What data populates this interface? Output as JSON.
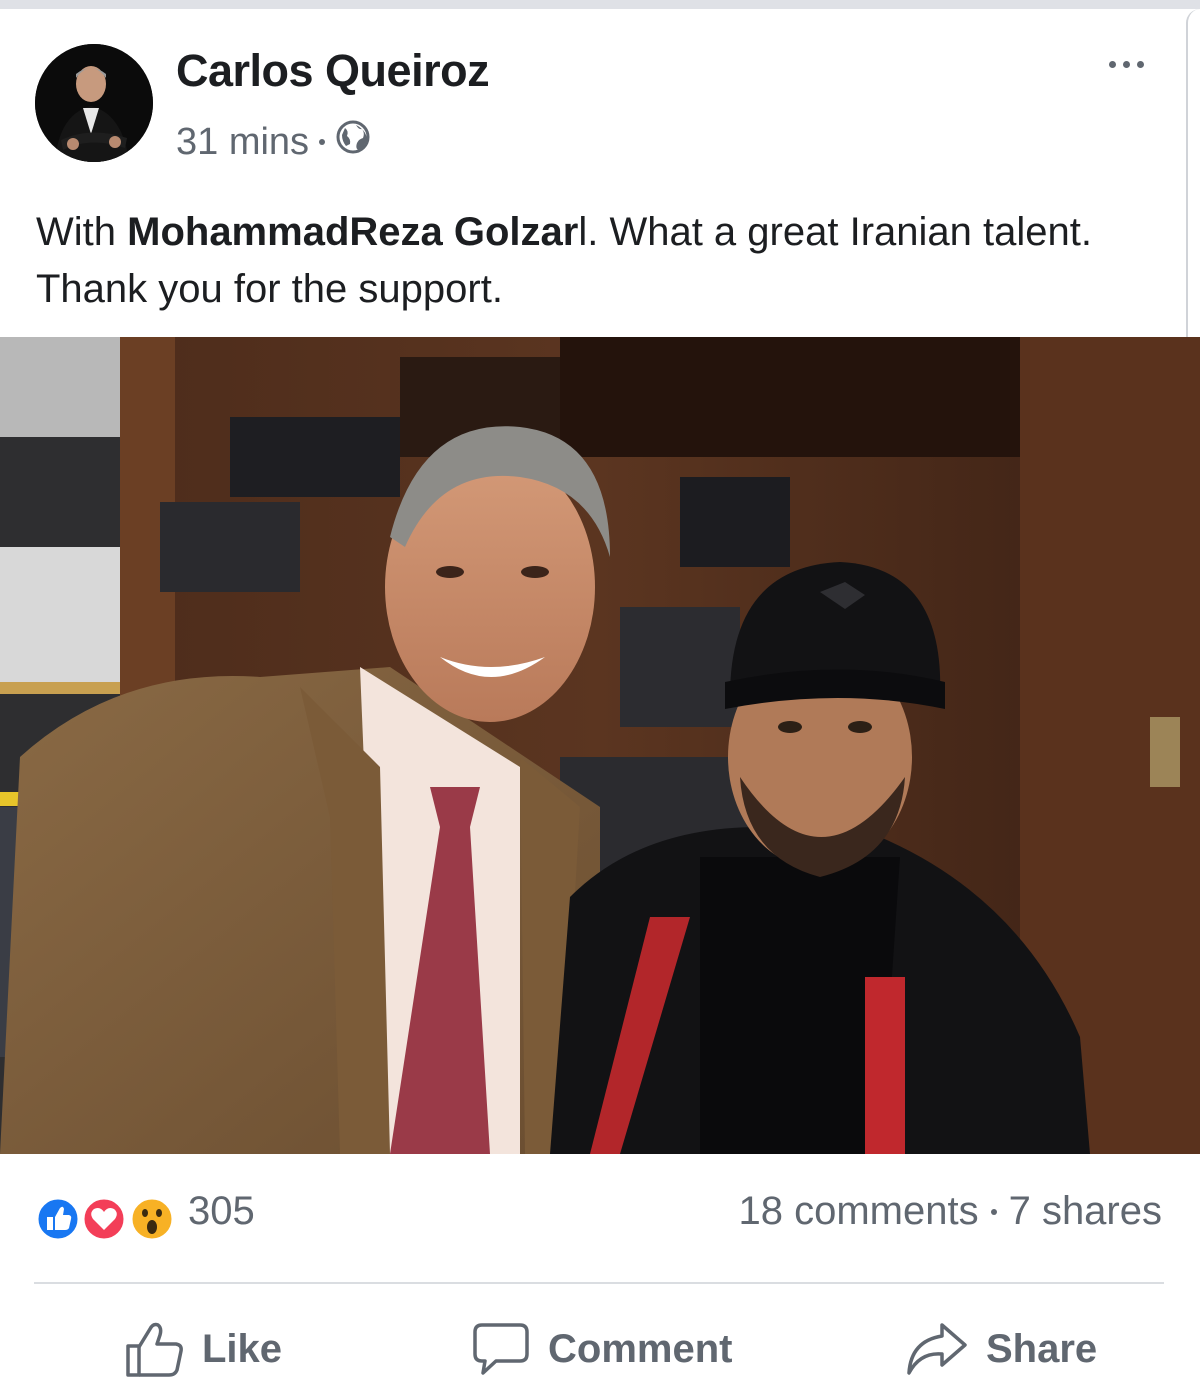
{
  "post": {
    "author": "Carlos Queiroz",
    "time": "31 mins",
    "privacy_icon": "globe-icon",
    "more_icon": "more-options-icon",
    "text": {
      "prefix": "With ",
      "tagged": "MohammadReza Golzar",
      "suffix": "l. What a great Iranian talent. Thank you for the support."
    }
  },
  "reactions": {
    "icons": [
      "like-reaction-icon",
      "love-reaction-icon",
      "wow-reaction-icon"
    ],
    "count": "305",
    "comments": "18 comments",
    "shares": "7 shares"
  },
  "actions": {
    "like": "Like",
    "comment": "Comment",
    "share": "Share"
  },
  "colors": {
    "like_blue": "#1877f2",
    "love_red": "#f33e58",
    "wow_yellow": "#f7b125",
    "secondary_text": "#606770"
  }
}
